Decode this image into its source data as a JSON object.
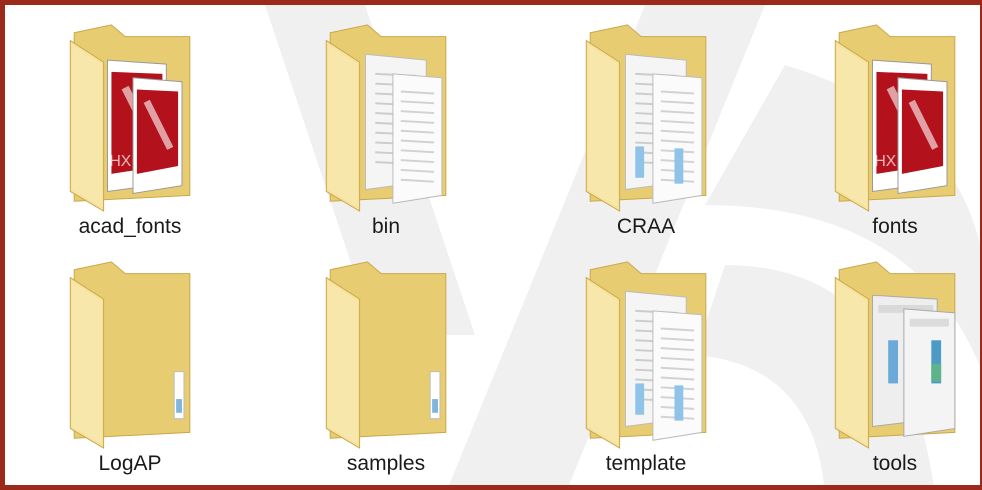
{
  "folders": [
    {
      "name": "acad_fonts",
      "icon": "font-file-folder-icon",
      "contents": "fonts",
      "badge": "HX"
    },
    {
      "name": "bin",
      "icon": "document-folder-icon",
      "contents": "docs"
    },
    {
      "name": "CRAA",
      "icon": "document-folder-icon",
      "contents": "docs-chart"
    },
    {
      "name": "fonts",
      "icon": "font-file-folder-icon",
      "contents": "fonts",
      "badge": "HX"
    },
    {
      "name": "LogAP",
      "icon": "folder-icon",
      "contents": "empty"
    },
    {
      "name": "samples",
      "icon": "folder-icon",
      "contents": "empty"
    },
    {
      "name": "template",
      "icon": "document-folder-icon",
      "contents": "docs-chart"
    },
    {
      "name": "tools",
      "icon": "window-folder-icon",
      "contents": "windows"
    }
  ],
  "colors": {
    "frame_border": "#9b2a1a",
    "folder_back": "#e8cc72",
    "folder_front": "#f6e3a0",
    "font_red": "#b3121c",
    "watermark": "#000000"
  }
}
